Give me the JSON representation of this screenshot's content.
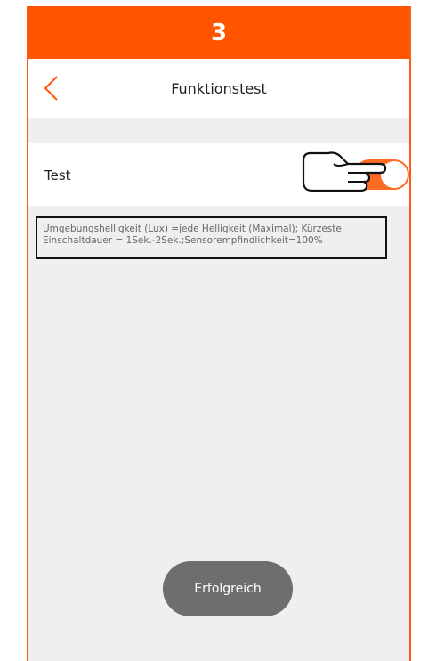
{
  "step": {
    "number": "3"
  },
  "header": {
    "title": "Funktionstest",
    "back_icon": "chevron-left-icon"
  },
  "test": {
    "label": "Test",
    "toggle_on": true,
    "hand_icon": "pointing-hand-icon"
  },
  "info": {
    "line1": "Umgebungshelligkeit (Lux) =jede Helligkeit (Maximal); Kürzeste",
    "line2": "Einschaltdauer = 1Sek.-2Sek.;Sensorempfindlichkeit=100%"
  },
  "toast": {
    "message": "Erfolgreich"
  },
  "colors": {
    "accent": "#ff5500",
    "background": "#efefef",
    "toast": "#6e6e6e"
  }
}
